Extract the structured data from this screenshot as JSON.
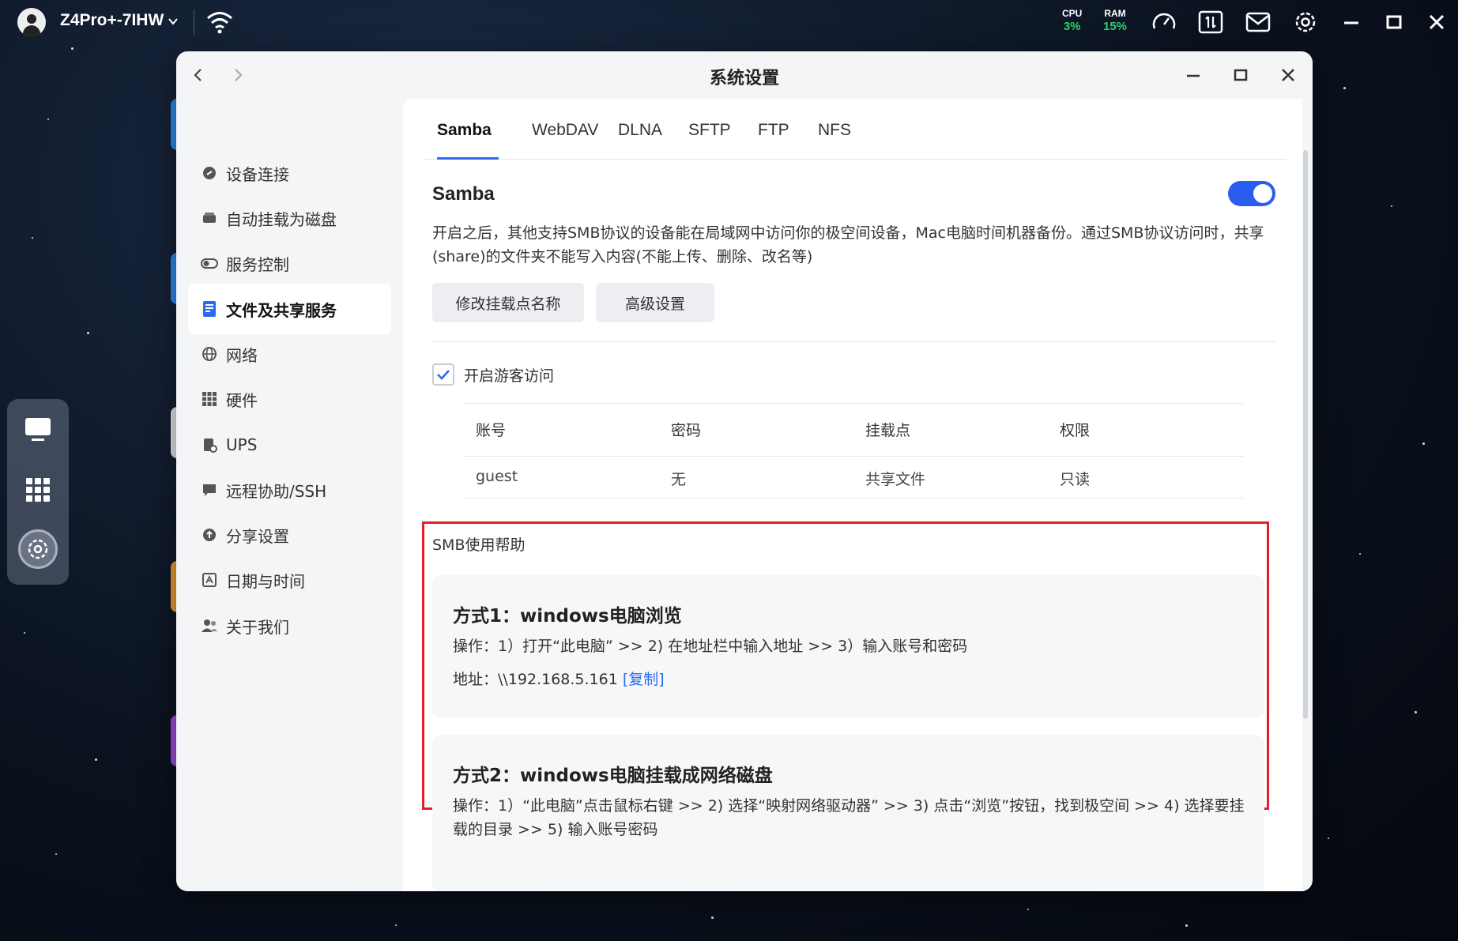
{
  "topbar": {
    "device_name": "Z4Pro+-7IHW",
    "cpu_label": "CPU",
    "cpu_value": "3%",
    "ram_label": "RAM",
    "ram_value": "15%",
    "icons": [
      "dashboard-icon",
      "resource-monitor-icon",
      "mail-icon",
      "settings-icon",
      "minimize-icon",
      "maximize-icon",
      "close-icon"
    ]
  },
  "window": {
    "title": "系统设置"
  },
  "sidebar": {
    "items": [
      {
        "label": "设备连接",
        "icon": "link-icon"
      },
      {
        "label": "自动挂载为磁盘",
        "icon": "drive-icon"
      },
      {
        "label": "服务控制",
        "icon": "toggle-icon"
      },
      {
        "label": "文件及共享服务",
        "icon": "file-share-icon",
        "active": true
      },
      {
        "label": "网络",
        "icon": "globe-icon"
      },
      {
        "label": "硬件",
        "icon": "grid-icon"
      },
      {
        "label": "UPS",
        "icon": "ups-icon"
      },
      {
        "label": "远程协助/SSH",
        "icon": "chat-icon"
      },
      {
        "label": "分享设置",
        "icon": "share-icon"
      },
      {
        "label": "日期与时间",
        "icon": "calendar-icon"
      },
      {
        "label": "关于我们",
        "icon": "users-icon"
      }
    ]
  },
  "tabs": [
    "Samba",
    "WebDAV",
    "DLNA",
    "SFTP",
    "FTP",
    "NFS"
  ],
  "samba": {
    "title": "Samba",
    "enabled": true,
    "description": "开启之后，其他支持SMB协议的设备能在局域网中访问你的极空间设备，Mac电脑时间机器备份。通过SMB协议访问时，共享(share)的文件夹不能写入内容(不能上传、删除、改名等)",
    "rename_button": "修改挂载点名称",
    "advanced_button": "高级设置",
    "guest_access_label": "开启游客访问",
    "guest_access_checked": true
  },
  "table": {
    "headers": [
      "账号",
      "密码",
      "挂载点",
      "权限"
    ],
    "rows": [
      [
        "guest",
        "无",
        "共享文件",
        "只读"
      ]
    ]
  },
  "help": {
    "title": "SMB使用帮助",
    "method1_title": "方式1：windows电脑浏览",
    "method1_steps": "操作：1）打开“此电脑” >> 2) 在地址栏中输入地址 >> 3）输入账号和密码",
    "address_label": "地址：",
    "address_value": "\\\\192.168.5.161",
    "copy_link": "[复制]",
    "method2_title": "方式2：windows电脑挂载成网络磁盘",
    "method2_steps": "操作：1）“此电脑”点击鼠标右键 >> 2) 选择“映射网络驱动器” >> 3) 点击“浏览”按钮，找到极空间 >> 4) 选择要挂载的目录 >> 5) 输入账号密码"
  },
  "colors": {
    "accent": "#2a6cf0",
    "toggle_on": "#2b5cf0",
    "highlight_border": "#e0202a",
    "stat_green": "#29d46b"
  }
}
